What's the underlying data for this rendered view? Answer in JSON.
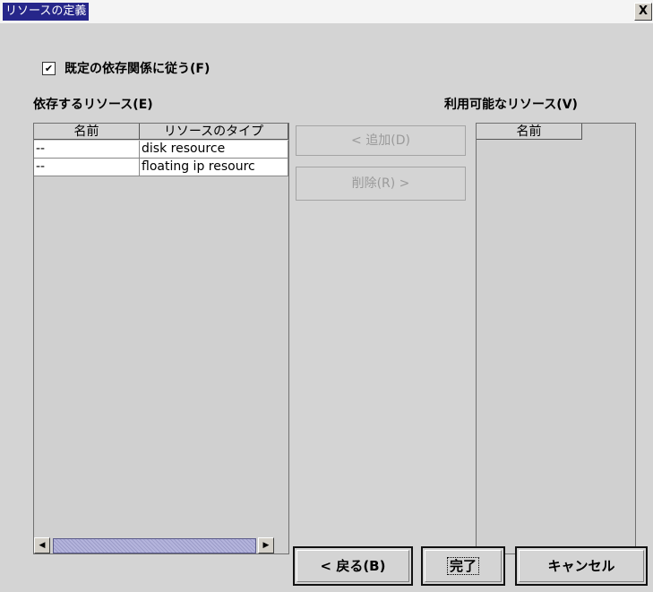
{
  "window": {
    "title": "リソースの定義",
    "close_label": "X"
  },
  "follow_default": {
    "checked_mark": "✔",
    "label": "既定の依存関係に従う(F)",
    "checked": true
  },
  "dependent": {
    "label": "依存するリソース(E)",
    "columns": [
      "名前",
      "リソースのタイプ"
    ],
    "rows": [
      {
        "name": "--",
        "type": "disk resource"
      },
      {
        "name": "--",
        "type": "floating ip resourc"
      }
    ]
  },
  "available": {
    "label": "利用可能なリソース(V)",
    "columns": [
      "名前"
    ]
  },
  "actions": {
    "add": "< 追加(D)",
    "remove": "削除(R) >"
  },
  "footer": {
    "back": "< 戻る(B)",
    "finish": "完了",
    "cancel": "キャンセル"
  },
  "scroll_arrows": {
    "left": "◀",
    "right": "▶"
  }
}
